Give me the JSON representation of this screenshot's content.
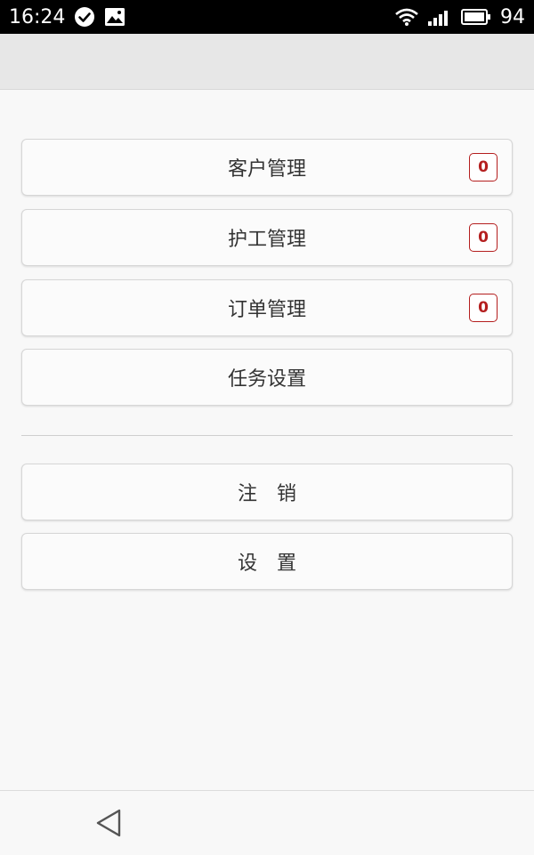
{
  "status_bar": {
    "time": "16:24",
    "battery": "94",
    "icons": [
      "check-circle-icon",
      "image-icon",
      "wifi-icon",
      "signal-icon",
      "battery-icon"
    ]
  },
  "menu": {
    "items": [
      {
        "label": "客户管理",
        "badge": "0"
      },
      {
        "label": "护工管理",
        "badge": "0"
      },
      {
        "label": "订单管理",
        "badge": "0"
      },
      {
        "label": "任务设置"
      }
    ],
    "secondary": [
      {
        "label": "注　销"
      },
      {
        "label": "设　置"
      }
    ]
  },
  "nav_bar": {
    "icon": "back-triangle-icon"
  },
  "colors": {
    "badge": "#b41e1e",
    "app_bar": "#e7e7e7",
    "background": "#f8f8f8"
  }
}
